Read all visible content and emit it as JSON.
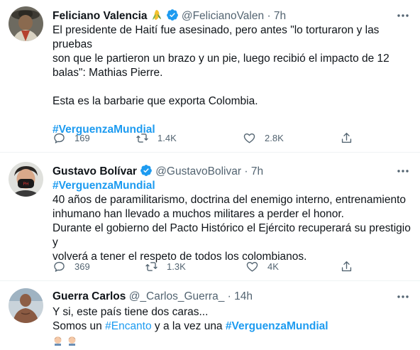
{
  "tweets": [
    {
      "name": "Feliciano Valencia",
      "handle": "@FelicianoValen",
      "dot": "·",
      "time": "7h",
      "lines": [
        "El presidente de Haití fue asesinado, pero antes \"lo torturaron y las pruebas",
        "son que le partieron un brazo y un pie, luego recibió el impacto de 12",
        "balas\": Mathias Pierre.",
        "",
        "Esta es la barbarie que exporta Colombia.",
        ""
      ],
      "hashtag": "#VerguenzaMundial",
      "replies": "169",
      "retweets": "1.4K",
      "likes": "2.8K"
    },
    {
      "name": "Gustavo Bolívar",
      "handle": "@GustavoBolivar",
      "dot": "·",
      "time": "7h",
      "hashtag": "#VerguenzaMundial",
      "lines": [
        "40 años de paramilitarismo, doctrina del enemigo interno, entrenamiento",
        "inhumano han llevado a muchos militares a perder el honor.",
        "Durante el gobierno del Pacto Histórico el Ejército recuperará su prestigio y",
        "volverá a tener el respeto de todos los colombianos."
      ],
      "replies": "369",
      "retweets": "1.3K",
      "likes": "4K"
    },
    {
      "name": "Guerra Carlos",
      "handle": "@_Carlos_Guerra_",
      "dot": "·",
      "time": "14h",
      "line1": "Y si, este país tiene dos caras...",
      "line2_a": "Somos un ",
      "line2_tag1": "#Encanto",
      "line2_b": " y a la vez una ",
      "line2_tag2": "#VerguenzaMundial"
    }
  ],
  "colors": {
    "accent": "#1d9bf0",
    "text": "#0f1419",
    "secondary": "#536471",
    "divider": "#eff3f4"
  }
}
